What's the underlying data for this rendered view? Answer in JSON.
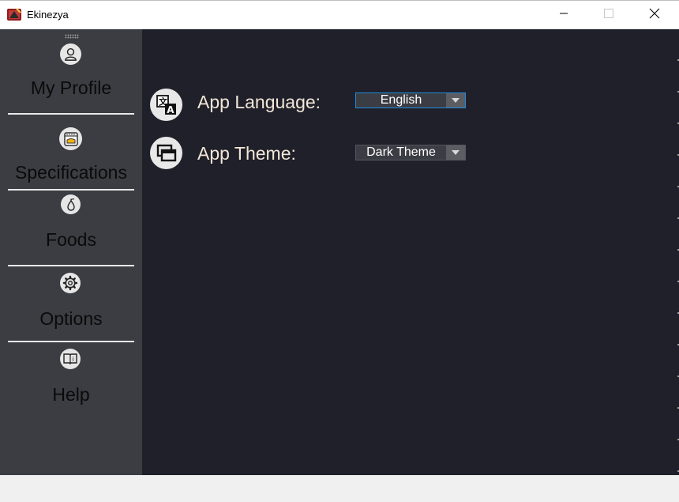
{
  "window": {
    "title": "Ekinezya",
    "controls": {
      "minimize": "minimize-icon",
      "maximize": "maximize-icon",
      "close": "close-icon"
    }
  },
  "sidebar": {
    "items": [
      {
        "label": "My Profile",
        "icon": "profile-icon"
      },
      {
        "label": "Specifications",
        "icon": "oven-icon"
      },
      {
        "label": "Foods",
        "icon": "pear-icon"
      },
      {
        "label": "Options",
        "icon": "gear-icon"
      },
      {
        "label": "Help",
        "icon": "book-icon"
      }
    ]
  },
  "options": {
    "language": {
      "label": "App Language:",
      "value": "English",
      "icon": "translate-icon"
    },
    "theme": {
      "label": "App Theme:",
      "value": "Dark Theme",
      "icon": "windows-icon"
    }
  },
  "colors": {
    "sidebar_bg": "#3c3d43",
    "content_bg": "#20202a",
    "label_text": "#f2e7d8",
    "focus_border": "#1e8ce0"
  }
}
